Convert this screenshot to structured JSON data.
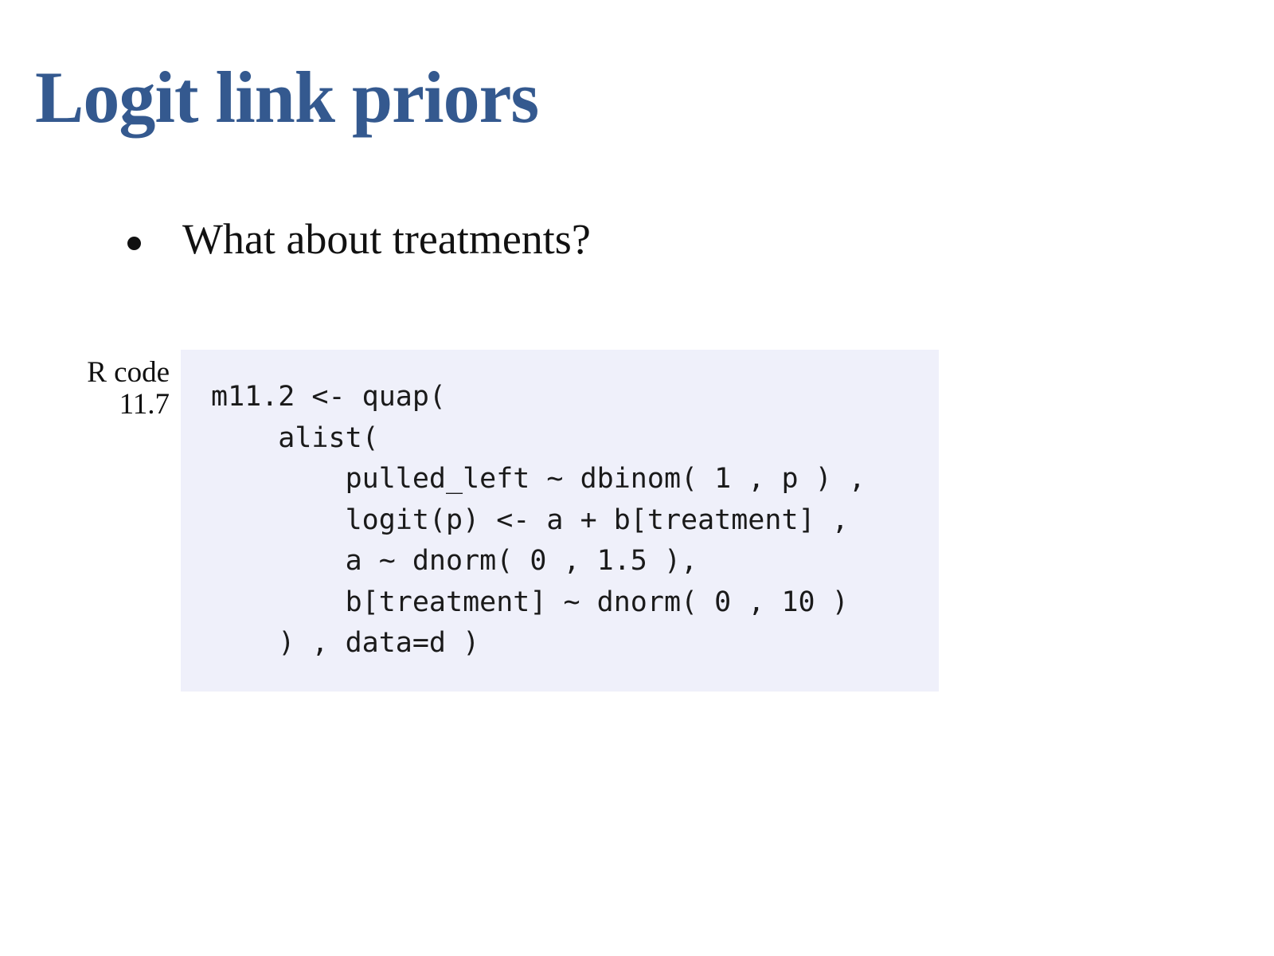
{
  "slide": {
    "title": "Logit link priors",
    "bullets": [
      "What about treatments?"
    ]
  },
  "code": {
    "label_line1": "R code",
    "label_line2": "11.7",
    "lines": [
      "m11.2 <- quap(",
      "    alist(",
      "        pulled_left ~ dbinom( 1 , p ) ,",
      "        logit(p) <- a + b[treatment] ,",
      "        a ~ dnorm( 0 , 1.5 ),",
      "        b[treatment] ~ dnorm( 0 , 10 )",
      "    ) , data=d )"
    ]
  },
  "colors": {
    "title": "#34598f",
    "code_background": "#eff0fa",
    "text": "#111111"
  }
}
